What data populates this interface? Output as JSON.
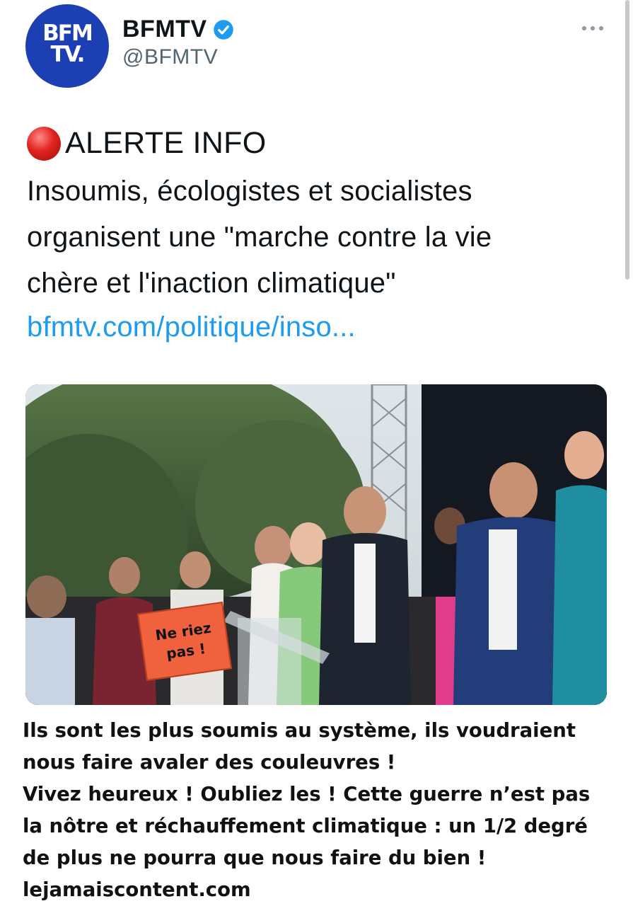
{
  "account": {
    "avatar_line1": "BFM",
    "avatar_line2": "TV.",
    "display_name": "BFMTV",
    "handle": "@BFMTV",
    "verified_icon": "verified-badge-icon",
    "brand_color": "#1c3fb4"
  },
  "tweet": {
    "alert_icon": "red-circle-icon",
    "alert_label": "ALERTE INFO",
    "body_lines": [
      "Insoumis, écologistes et socialistes",
      "organisent une \"marche contre la vie",
      "chère et l'inaction climatique\""
    ],
    "link_text": "bfmtv.com/politique/inso...",
    "link_color": "#1d9bf0",
    "more_icon": "more-options-icon"
  },
  "photo": {
    "sign_line1": "Ne riez",
    "sign_line2": "pas !"
  },
  "caption": {
    "lines": [
      "Ils sont les plus soumis au système, ils voudraient",
      "nous faire avaler des couleuvres  !",
      "Vivez heureux ! Oubliez les ! Cette  guerre n’est pas",
      "la  nôtre et réchauffement climatique : un 1/2 degré",
      "de plus ne pourra que nous faire du bien !",
      "lejamaiscontent.com"
    ]
  }
}
